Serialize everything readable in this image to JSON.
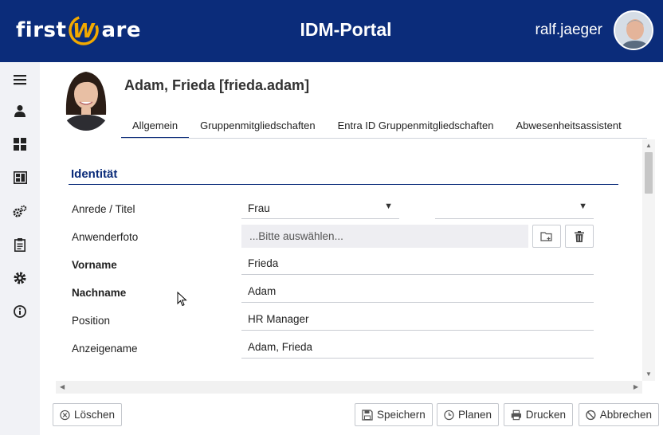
{
  "header": {
    "logo_left": "first",
    "logo_w": "W",
    "logo_right": "are",
    "title": "IDM-Portal",
    "username": "ralf.jaeger"
  },
  "sidebar": {
    "items": [
      {
        "icon": "menu-icon"
      },
      {
        "icon": "person-icon"
      },
      {
        "icon": "dashboard-icon"
      },
      {
        "icon": "catalog-icon"
      },
      {
        "icon": "gears-icon"
      },
      {
        "icon": "clipboard-icon"
      },
      {
        "icon": "gear-icon"
      },
      {
        "icon": "info-icon"
      }
    ]
  },
  "profile": {
    "name": "Adam, Frieda [frieda.adam]"
  },
  "tabs": [
    {
      "label": "Allgemein",
      "active": true
    },
    {
      "label": "Gruppenmitgliedschaften",
      "active": false
    },
    {
      "label": "Entra ID Gruppenmitgliedschaften",
      "active": false
    },
    {
      "label": "Abwesenheitsassistent",
      "active": false
    }
  ],
  "section": {
    "title": "Identität"
  },
  "form": {
    "anrede_label": "Anrede / Titel",
    "anrede_value": "Frau",
    "titel_value": "",
    "foto_label": "Anwenderfoto",
    "foto_placeholder": "...Bitte auswählen...",
    "vorname_label": "Vorname",
    "vorname_value": "Frieda",
    "nachname_label": "Nachname",
    "nachname_value": "Adam",
    "position_label": "Position",
    "position_value": "HR Manager",
    "anzeigename_label": "Anzeigename",
    "anzeigename_value": "Adam, Frieda"
  },
  "footer": {
    "delete": "Löschen",
    "save": "Speichern",
    "plan": "Planen",
    "print": "Drucken",
    "cancel": "Abbrechen"
  },
  "colors": {
    "brand": "#0b2c7a",
    "logo_accent": "#f2a900"
  }
}
